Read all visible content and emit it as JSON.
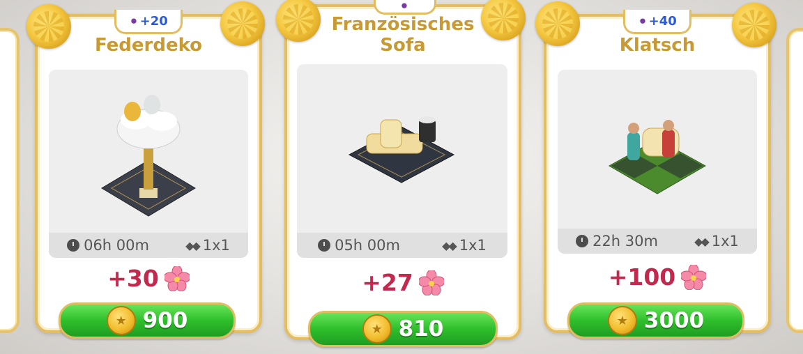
{
  "cards": [
    {
      "badge": "+20",
      "title": "Federdeko",
      "time": "06h 00m",
      "size": "1x1",
      "reward": "+30",
      "price": "900",
      "reward_icon": "flower-icon",
      "badge_icon": "purple-jar-icon"
    },
    {
      "badge": "",
      "title": "Französisches Sofa",
      "time": "05h 00m",
      "size": "1x1",
      "reward": "+27",
      "price": "810",
      "reward_icon": "flower-icon",
      "badge_icon": "purple-jar-icon"
    },
    {
      "badge": "+40",
      "title": "Klatsch",
      "time": "22h 30m",
      "size": "1x1",
      "reward": "+100",
      "price": "3000",
      "reward_icon": "flower-icon",
      "badge_icon": "purple-jar-icon"
    }
  ],
  "colors": {
    "title": "#c79a34",
    "reward": "#c3284d",
    "button_green": "#2fbf2c",
    "gold_border": "#e3bd5f"
  }
}
